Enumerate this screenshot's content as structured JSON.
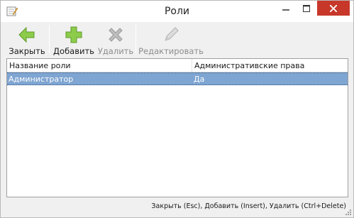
{
  "window": {
    "title": "Роли"
  },
  "toolbar": {
    "close_label": "Закрыть",
    "add_label": "Добавить",
    "delete_label": "Удалить",
    "edit_label": "Редактировать"
  },
  "table": {
    "columns": [
      "Название роли",
      "Административские права"
    ],
    "rows": [
      {
        "name": "Администратор",
        "admin": "Да"
      }
    ]
  },
  "statusbar": {
    "hint": "Закрыть (Esc), Добавить (Insert), Удалить (Ctrl+Delete)"
  },
  "icons": {
    "app": "edit-form-icon",
    "close": "green-arrow-left-icon",
    "add": "green-plus-icon",
    "delete": "gray-cross-icon",
    "edit": "pencil-icon"
  },
  "colors": {
    "accent_green": "#7ec242",
    "selection": "#7fa5d2",
    "close_button": "#c7382b"
  }
}
